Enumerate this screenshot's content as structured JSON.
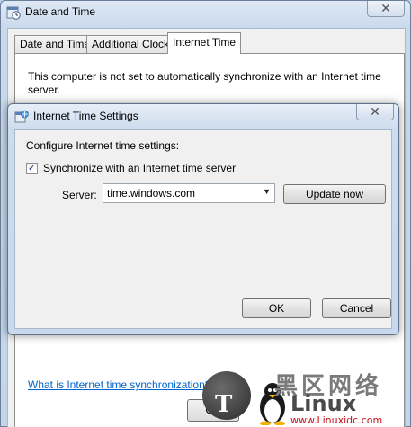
{
  "outer_window": {
    "title": "Date and Time",
    "close_glyph": "✕",
    "tabs": [
      {
        "label": "Date and Time"
      },
      {
        "label": "Additional Clocks"
      },
      {
        "label": "Internet Time"
      }
    ],
    "active_tab": "Internet Time",
    "status_text": "This computer is not set to automatically synchronize with an Internet time server.",
    "help_link": "What is Internet time synchronization?",
    "ok_label": "OK"
  },
  "dialog": {
    "title": "Internet Time Settings",
    "close_glyph": "✕",
    "configure_label": "Configure Internet time settings:",
    "sync_label": "Synchronize with an Internet time server",
    "sync_checked": true,
    "checkbox_glyph": "✓",
    "server_label": "Server:",
    "server_value": "time.windows.com",
    "dropdown_glyph": "▼",
    "update_label": "Update now",
    "ok_label": "OK",
    "cancel_label": "Cancel"
  },
  "watermark": {
    "logo_letter": "T",
    "cn_text": "黑区网络",
    "brand": "Linux",
    "url": "www.Linuxidc.com",
    "brand_color": "#c8111a"
  },
  "icons": {
    "window_icon": "date-time-icon",
    "dialog_icon": "internet-time-icon"
  }
}
